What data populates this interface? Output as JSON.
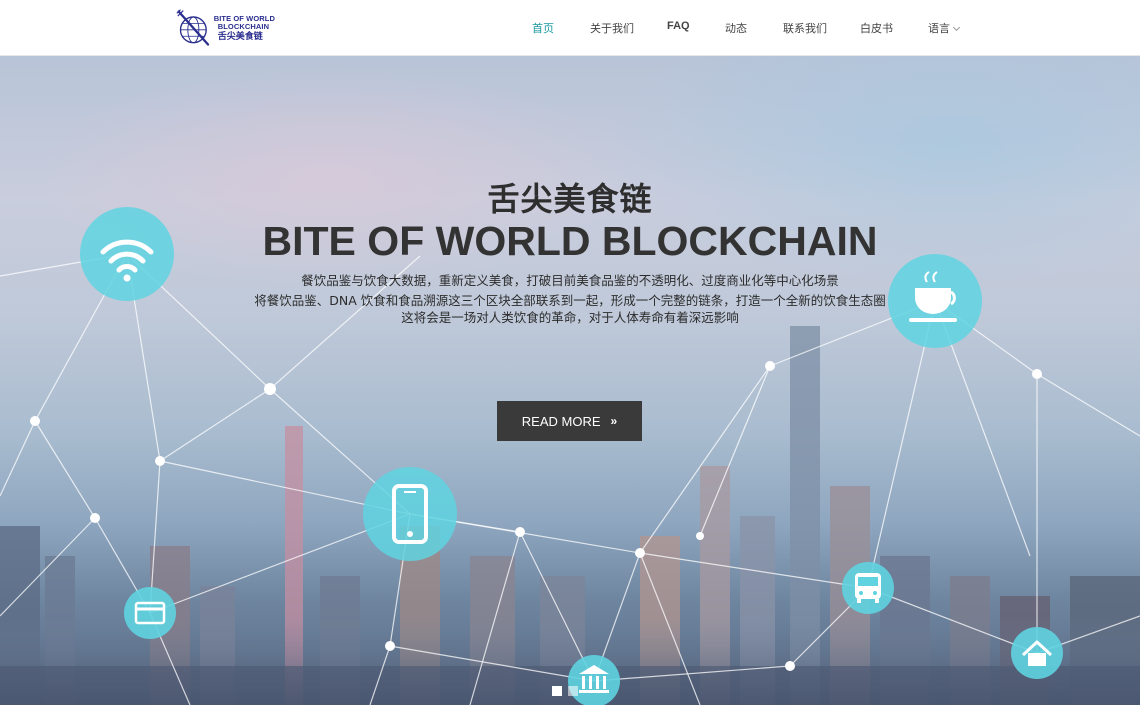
{
  "brand": {
    "logo_line1": "BITE OF WORLD",
    "logo_line2": "BLOCKCHAIN",
    "logo_cn": "舌尖美食链"
  },
  "nav": {
    "items": [
      {
        "label": "首页",
        "active": true
      },
      {
        "label": "关于我们",
        "active": false
      },
      {
        "label": "FAQ",
        "active": false
      },
      {
        "label": "动态",
        "active": false
      },
      {
        "label": "联系我们",
        "active": false
      },
      {
        "label": "白皮书",
        "active": false
      },
      {
        "label": "语言",
        "active": false
      }
    ],
    "active_color": "#1a9aa0"
  },
  "hero": {
    "title_cn": "舌尖美食链",
    "title_en": "BITE OF WORLD BLOCKCHAIN",
    "desc_lines": [
      "餐饮品鉴与饮食大数据，重新定义美食，打破目前美食品鉴的不透明化、过度商业化等中心化场景",
      "将餐饮品鉴、DNA 饮食和食品溯源这三个区块全部联系到一起，形成一个完整的链条，打造一个全新的饮食生态圈",
      "这将会是一场对人类饮食的革命，对于人体寿命有着深远影响"
    ],
    "button_label": "READ MORE",
    "button_arrow": "»",
    "slides": 2,
    "active_slide": 0,
    "icons": [
      "wifi-icon",
      "coffee-cup-icon",
      "smartphone-icon",
      "credit-card-icon",
      "bus-icon",
      "bank-icon",
      "home-icon"
    ],
    "node_color": "#5fd3e0"
  }
}
